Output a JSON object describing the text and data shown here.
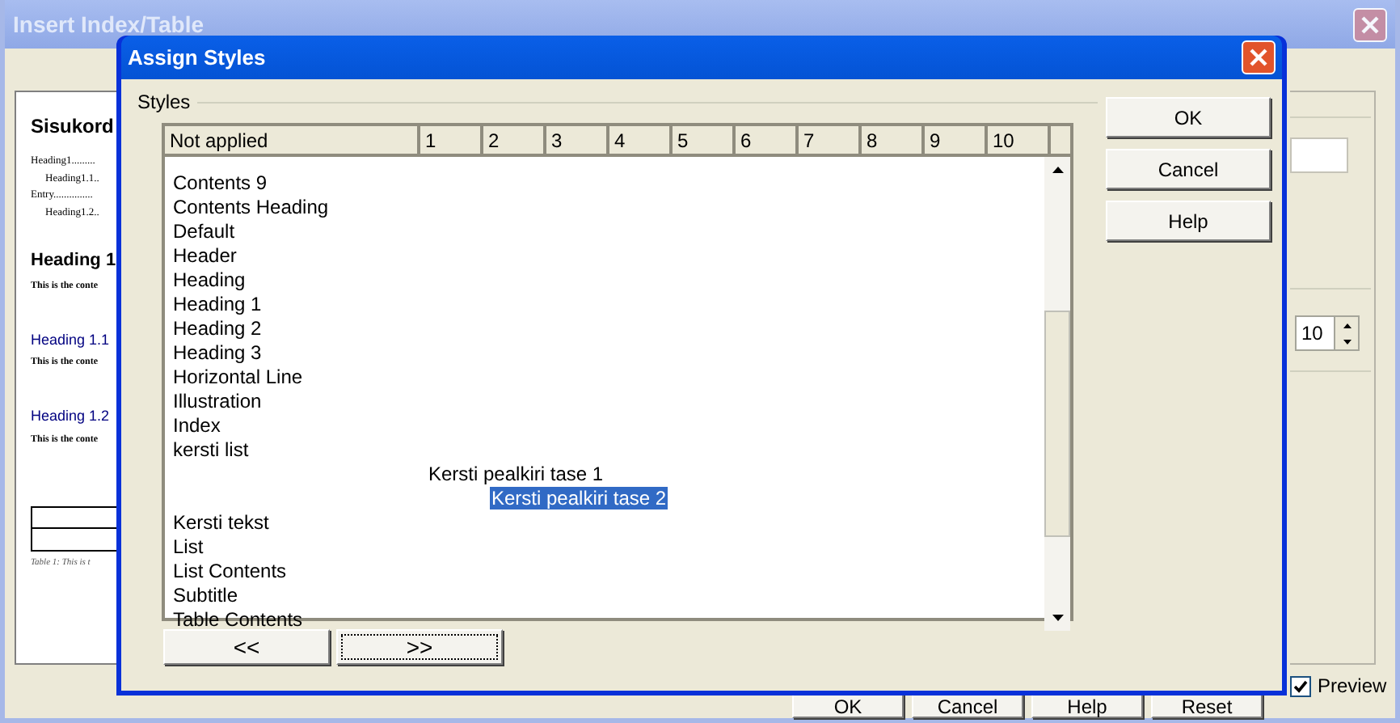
{
  "back_window": {
    "title": "Insert Index/Table",
    "preview": {
      "title": "Sisukord",
      "toc": [
        {
          "text": "Heading1.........",
          "indented": false
        },
        {
          "text": "Heading1.1..",
          "indented": true
        },
        {
          "text": "Entry...............",
          "indented": false
        },
        {
          "text": "Heading1.2..",
          "indented": true
        }
      ],
      "sections": [
        {
          "heading": "Heading 1",
          "kind": "main",
          "body": "This is the conte"
        },
        {
          "heading": "Heading 1.1",
          "kind": "sub",
          "body": "This is the conte"
        },
        {
          "heading": "Heading 1.2",
          "kind": "sub",
          "body": "This is the conte"
        }
      ],
      "caption": "Table 1: This is t"
    },
    "spin_value": "10",
    "buttons": [
      "OK",
      "Cancel",
      "Help",
      "Reset"
    ],
    "preview_checkbox": {
      "label": "Preview",
      "checked": true
    }
  },
  "dialog": {
    "title": "Assign Styles",
    "group_label": "Styles",
    "columns": [
      "Not applied",
      "1",
      "2",
      "3",
      "4",
      "5",
      "6",
      "7",
      "8",
      "9",
      "10"
    ],
    "styles": [
      {
        "name": "Contents 9",
        "kind": "not_applied",
        "selected": false
      },
      {
        "name": "Contents Heading",
        "kind": "not_applied",
        "selected": false
      },
      {
        "name": "Default",
        "kind": "not_applied",
        "selected": false
      },
      {
        "name": "Header",
        "kind": "not_applied",
        "selected": false
      },
      {
        "name": "Heading",
        "kind": "not_applied",
        "selected": false
      },
      {
        "name": "Heading 1",
        "kind": "not_applied",
        "selected": false
      },
      {
        "name": "Heading 2",
        "kind": "not_applied",
        "selected": false
      },
      {
        "name": "Heading 3",
        "kind": "not_applied",
        "selected": false
      },
      {
        "name": "Horizontal Line",
        "kind": "not_applied",
        "selected": false
      },
      {
        "name": "Illustration",
        "kind": "not_applied",
        "selected": false
      },
      {
        "name": "Index",
        "kind": "not_applied",
        "selected": false
      },
      {
        "name": "kersti list",
        "kind": "not_applied",
        "selected": false
      },
      {
        "name": "Kersti pealkiri tase 1",
        "kind": "level_one",
        "selected": false
      },
      {
        "name": "Kersti pealkiri tase 2",
        "kind": "level_two",
        "selected": true
      },
      {
        "name": "Kersti tekst",
        "kind": "not_applied",
        "selected": false
      },
      {
        "name": "List",
        "kind": "not_applied",
        "selected": false
      },
      {
        "name": "List Contents",
        "kind": "not_applied",
        "selected": false
      },
      {
        "name": "Subtitle",
        "kind": "not_applied",
        "selected": false
      },
      {
        "name": "Table Contents",
        "kind": "not_applied",
        "selected": false
      }
    ],
    "move_buttons": [
      {
        "label": "<<",
        "focused": false
      },
      {
        "label": ">>",
        "focused": true
      }
    ],
    "buttons": [
      "OK",
      "Cancel",
      "Help"
    ]
  }
}
